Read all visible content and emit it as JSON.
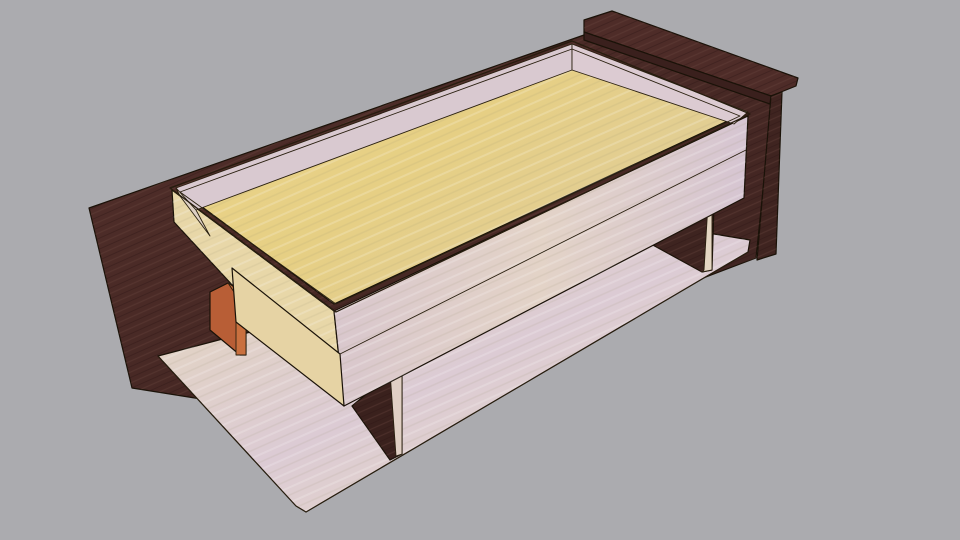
{
  "viewport": {
    "background": "#ababaf"
  },
  "model": {
    "materials": {
      "walnut": "#4a2a26",
      "walnut_dark": "#3a201d",
      "pine_light": "#e8d8b0",
      "pine_face": "#e4cfa6",
      "tray_floor": "#e9d486",
      "tray_rim": "#f2e35e",
      "lavender_board": "#d8c8d2",
      "block": "#c46a3e"
    }
  }
}
